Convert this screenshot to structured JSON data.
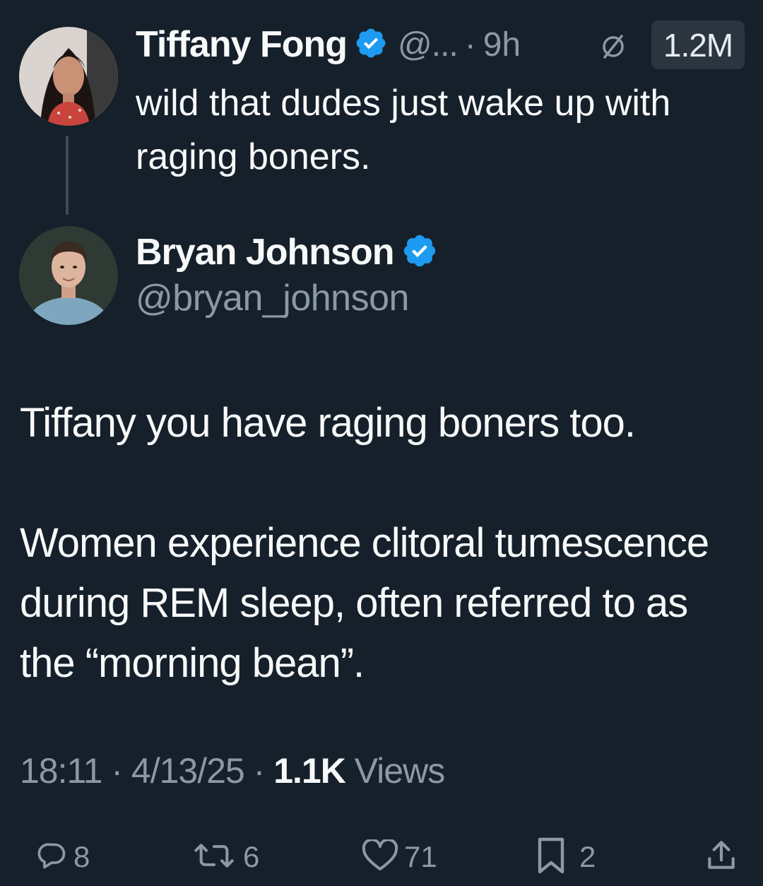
{
  "parent_tweet": {
    "author_name": "Tiffany Fong",
    "handle_truncated": "@...",
    "separator": "·",
    "time": "9h",
    "views_count": "1.2M",
    "text": "wild that dudes just wake up with raging boners.",
    "avatar_icon": "woman-portrait-avatar-icon"
  },
  "reply_tweet": {
    "author_name": "Bryan Johnson",
    "handle": "@bryan_johnson",
    "avatar_icon": "man-portrait-avatar-icon",
    "paragraph_1": "Tiffany you have raging boners too.",
    "paragraph_2": "Women experience clitoral tumescence during REM sleep, often referred to as the “morning bean”.",
    "timestamp_time": "18:11",
    "timestamp_date": "4/13/25",
    "separator": "·",
    "views_number": "1.1K",
    "views_label": "Views"
  },
  "actions": {
    "replies": "8",
    "reposts": "6",
    "likes": "71",
    "bookmarks": "2"
  },
  "colors": {
    "background": "#15202b",
    "text_primary": "#f7f9f9",
    "text_secondary": "#8b98a5",
    "verified_badge": "#1d9bf0"
  }
}
